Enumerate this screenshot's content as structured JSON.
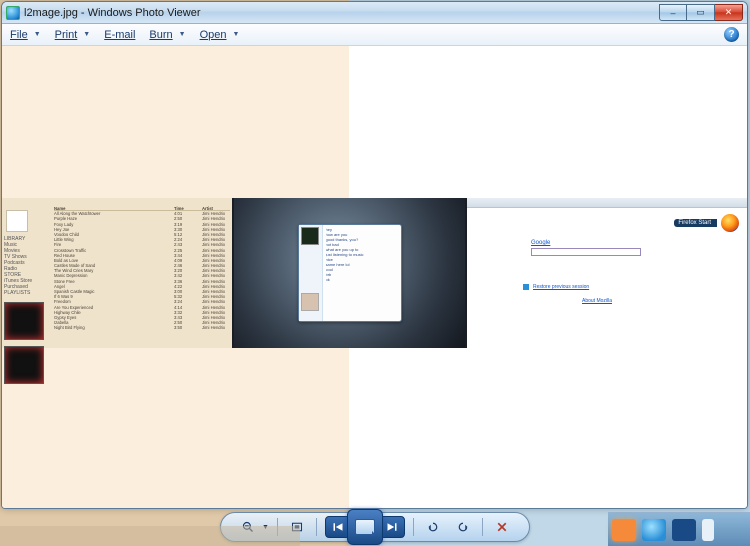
{
  "titlebar": {
    "filename": "l2mage.jpg",
    "app": "Windows Photo Viewer",
    "full": "l2mage.jpg - Windows Photo Viewer"
  },
  "window_controls": {
    "minimize": "–",
    "maximize": "▭",
    "close": "✕"
  },
  "menu": {
    "file": "File",
    "print": "Print",
    "email": "E-mail",
    "burn": "Burn",
    "open": "Open",
    "help": "?"
  },
  "panels": {
    "itunes": {
      "headers": [
        "Name",
        "Time",
        "Artist"
      ],
      "sidebar": [
        "LIBRARY",
        "Music",
        "Movies",
        "TV Shows",
        "Podcasts",
        "Radio",
        "STORE",
        "iTunes Store",
        "Purchased",
        "PLAYLISTS"
      ],
      "rows": [
        [
          "All Along the Watchtower",
          "4:01",
          "Jimi Hendrix"
        ],
        [
          "Purple Haze",
          "2:50",
          "Jimi Hendrix"
        ],
        [
          "Foxy Lady",
          "3:19",
          "Jimi Hendrix"
        ],
        [
          "Hey Joe",
          "3:30",
          "Jimi Hendrix"
        ],
        [
          "Voodoo Child",
          "5:12",
          "Jimi Hendrix"
        ],
        [
          "Little Wing",
          "2:24",
          "Jimi Hendrix"
        ],
        [
          "Fire",
          "2:43",
          "Jimi Hendrix"
        ],
        [
          "Crosstown Traffic",
          "2:25",
          "Jimi Hendrix"
        ],
        [
          "Red House",
          "3:44",
          "Jimi Hendrix"
        ],
        [
          "Bold as Love",
          "4:09",
          "Jimi Hendrix"
        ],
        [
          "Castles Made of Sand",
          "2:46",
          "Jimi Hendrix"
        ],
        [
          "The Wind Cries Mary",
          "3:20",
          "Jimi Hendrix"
        ],
        [
          "Manic Depression",
          "3:42",
          "Jimi Hendrix"
        ],
        [
          "Stone Free",
          "3:36",
          "Jimi Hendrix"
        ],
        [
          "Angel",
          "4:22",
          "Jimi Hendrix"
        ],
        [
          "Spanish Castle Magic",
          "3:00",
          "Jimi Hendrix"
        ],
        [
          "If 6 Was 9",
          "5:32",
          "Jimi Hendrix"
        ],
        [
          "Freedom",
          "3:24",
          "Jimi Hendrix"
        ],
        [
          "Are You Experienced",
          "4:14",
          "Jimi Hendrix"
        ],
        [
          "Highway Chile",
          "3:32",
          "Jimi Hendrix"
        ],
        [
          "Gypsy Eyes",
          "3:43",
          "Jimi Hendrix"
        ],
        [
          "Izabella",
          "2:50",
          "Jimi Hendrix"
        ],
        [
          "Night Bird Flying",
          "3:50",
          "Jimi Hendrix"
        ]
      ]
    },
    "chat": {
      "lines": [
        "hey",
        "how are you",
        "good thanks, you?",
        "not bad",
        "what are you up to",
        "just listening to music",
        "nice",
        "same here lol",
        "cool",
        "brb",
        "ok"
      ]
    },
    "firefox": {
      "brand": "Firefox Start",
      "google": "Google",
      "search_placeholder": "",
      "restore_link": "Restore previous session",
      "about_link": "About Mozilla"
    }
  },
  "controls": {
    "zoom": "🔍",
    "fit": "Fit",
    "prev": "◄",
    "play": "▶",
    "next": "►",
    "rotate_ccw": "↺",
    "rotate_cw": "↻",
    "delete": "✕"
  }
}
